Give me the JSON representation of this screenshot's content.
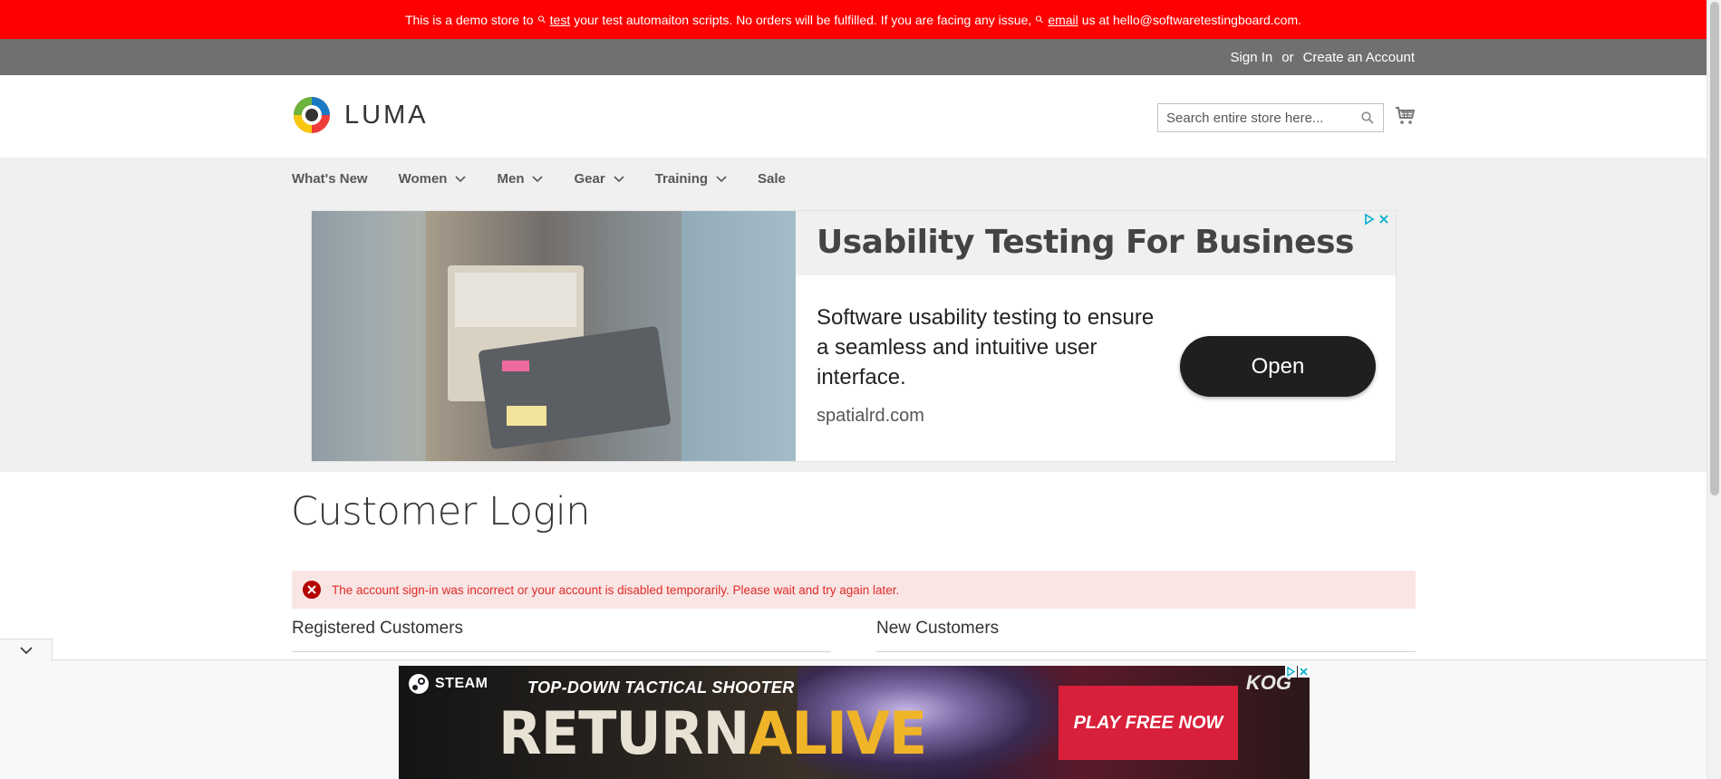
{
  "demo_banner": {
    "part1": "This is a demo store to",
    "link1": "test",
    "part2": "your test automaiton scripts. No orders will be fulfilled. If you are facing any issue,",
    "link2": "email",
    "part3": "us at hello@softwaretestingboard.com."
  },
  "header": {
    "sign_in": "Sign In",
    "or": "or",
    "create_account": "Create an Account"
  },
  "logo": {
    "text": "LUMA"
  },
  "search": {
    "placeholder": "Search entire store here...",
    "value": ""
  },
  "nav": {
    "items": [
      {
        "label": "What's New",
        "has_dropdown": false
      },
      {
        "label": "Women",
        "has_dropdown": true
      },
      {
        "label": "Men",
        "has_dropdown": true
      },
      {
        "label": "Gear",
        "has_dropdown": true
      },
      {
        "label": "Training",
        "has_dropdown": true
      },
      {
        "label": "Sale",
        "has_dropdown": false
      }
    ]
  },
  "ad_banner": {
    "title": "Usability Testing For Business",
    "body": "Software usability testing to ensure a seamless and intuitive user interface.",
    "domain": "spatialrd.com",
    "button": "Open"
  },
  "main": {
    "page_title": "Customer Login",
    "error_message": "The account sign-in was incorrect or your account is disabled temporarily. Please wait and try again later.",
    "registered_customers": "Registered Customers",
    "new_customers": "New Customers"
  },
  "sticky_ad": {
    "platform": "STEAM",
    "tagline": "TOP-DOWN TACTICAL SHOOTER",
    "game_part1": "RETURN",
    "game_part2": "ALIVE",
    "cta": "PLAY FREE NOW",
    "brand": "KOG"
  },
  "colors": {
    "demo_banner_bg": "#ff0000",
    "panel_header_bg": "#6e716e",
    "nav_bg": "#f0f0f0",
    "error_bg": "#fae5e5",
    "error_text": "#e02b27"
  }
}
